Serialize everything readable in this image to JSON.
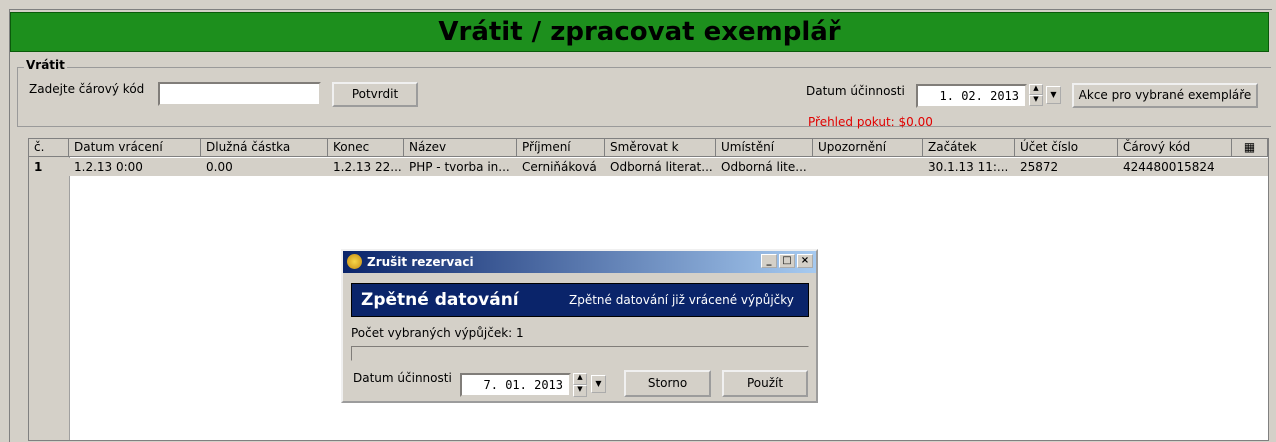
{
  "header": {
    "title": "Vrátit / zpracovat exemplář"
  },
  "return_group": {
    "label": "Vrátit",
    "barcode_label": "Zadejte čárový kód",
    "barcode_value": "",
    "confirm_button": "Potvrdit",
    "effective_date_label": "Datum účinnosti",
    "effective_date_value": "1. 02.  2013",
    "actions_button": "Akce pro vybrané exempláře",
    "fines_summary": "Přehled pokut: $0.00"
  },
  "grid": {
    "columns": [
      "č.",
      "Datum vrácení",
      "Dlužná částka",
      "Konec",
      "Název",
      "Příjmení",
      "Směrovat k",
      "Umístění",
      "Upozornění",
      "Začátek",
      "Účet číslo",
      "Čárový kód"
    ],
    "rows": [
      [
        "1",
        "1.2.13 0:00",
        "0.00",
        "1.2.13 22...",
        "PHP - tvorba in...",
        "Cerniňáková",
        "Odborná literat...",
        "Odborná lite...",
        "",
        "30.1.13 11:...",
        "25872",
        "424480015824"
      ]
    ]
  },
  "dialog": {
    "title": "Zrušit rezervaci",
    "banner_title": "Zpětné datování",
    "banner_subtitle": "Zpětné datování již vrácené výpůjčky",
    "selected_count": "Počet vybraných výpůjček: 1",
    "date_label": "Datum účinnosti",
    "date_value": "7. 01.  2013",
    "cancel_button": "Storno",
    "apply_button": "Použít"
  },
  "colors": {
    "title_bg": "#1d8f1d",
    "fines_text": "#e00000",
    "dialog_banner": "#0a246a"
  }
}
